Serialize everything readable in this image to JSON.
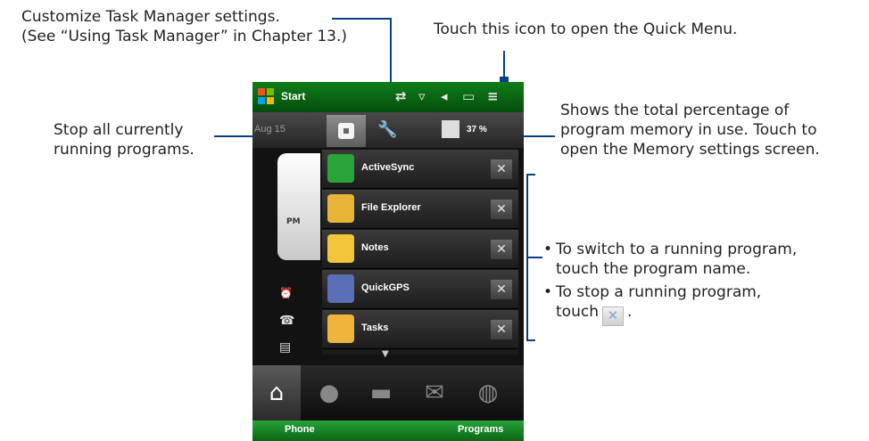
{
  "callouts": {
    "task_manager_settings_line1": "Customize Task Manager settings.",
    "task_manager_settings_line2": "(See “Using Task Manager” in Chapter 13.)",
    "quick_menu": "Touch this icon to open the Quick Menu.",
    "stop_all_line1": "Stop all currently",
    "stop_all_line2": "running programs.",
    "memory_line1": "Shows the total percentage of",
    "memory_line2": "program memory in use. Touch to",
    "memory_line3": "open the Memory settings screen.",
    "bullet1_line1": "To switch to a running program,",
    "bullet1_line2": "touch the program name.",
    "bullet2_line1": "To stop a running program,",
    "bullet2_line2": "touch",
    "bullet2_end": "."
  },
  "phone": {
    "title": "Start",
    "date": "Aug 15",
    "memory_percent": "37 %",
    "pm_label": "PM",
    "tasks": [
      {
        "name": "ActiveSync",
        "icon": "activesync-icon",
        "color": "#2aa43a"
      },
      {
        "name": "File Explorer",
        "icon": "file-explorer-icon",
        "color": "#e8b437"
      },
      {
        "name": "Notes",
        "icon": "notes-icon",
        "color": "#f2c53a"
      },
      {
        "name": "QuickGPS",
        "icon": "quickgps-icon",
        "color": "#5b6fb8"
      },
      {
        "name": "Tasks",
        "icon": "tasks-icon",
        "color": "#f0b33b"
      }
    ],
    "softkey_left": "Phone",
    "softkey_right": "Programs"
  },
  "colors": {
    "callout_line": "#0a3f84",
    "title_bar": "#0a6514"
  }
}
